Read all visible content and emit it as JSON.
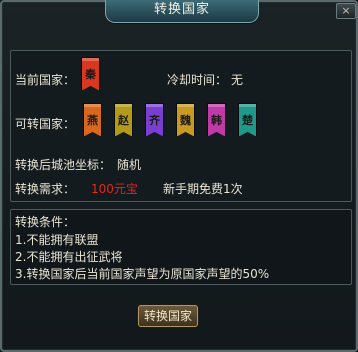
{
  "dialog": {
    "title": "转换国家",
    "close_glyph": "×"
  },
  "current": {
    "label": "当前国家：",
    "flag_char": "秦",
    "flag_color": "#d9371f"
  },
  "cooldown": {
    "label": "冷却时间：",
    "value": "无"
  },
  "targets": {
    "label": "可转国家：",
    "flags": [
      {
        "char": "燕",
        "color": "#d9681c"
      },
      {
        "char": "赵",
        "color": "#b39a17"
      },
      {
        "char": "齐",
        "color": "#7a3fd0"
      },
      {
        "char": "魏",
        "color": "#c99a22"
      },
      {
        "char": "韩",
        "color": "#c23aa8"
      },
      {
        "char": "楚",
        "color": "#1f9a8a"
      }
    ]
  },
  "coords": {
    "label": "转换后城池坐标：",
    "value": "随机"
  },
  "cost": {
    "label": "转换需求：",
    "value": "100元宝",
    "value_color": "#e3271e",
    "note": "新手期免费1次"
  },
  "conditions": {
    "title": "转换条件：",
    "items": [
      "1.不能拥有联盟",
      "2.不能拥有出征武将",
      "3.转换国家后当前国家声望为原国家声望的50%"
    ]
  },
  "button": {
    "label": "转换国家"
  }
}
